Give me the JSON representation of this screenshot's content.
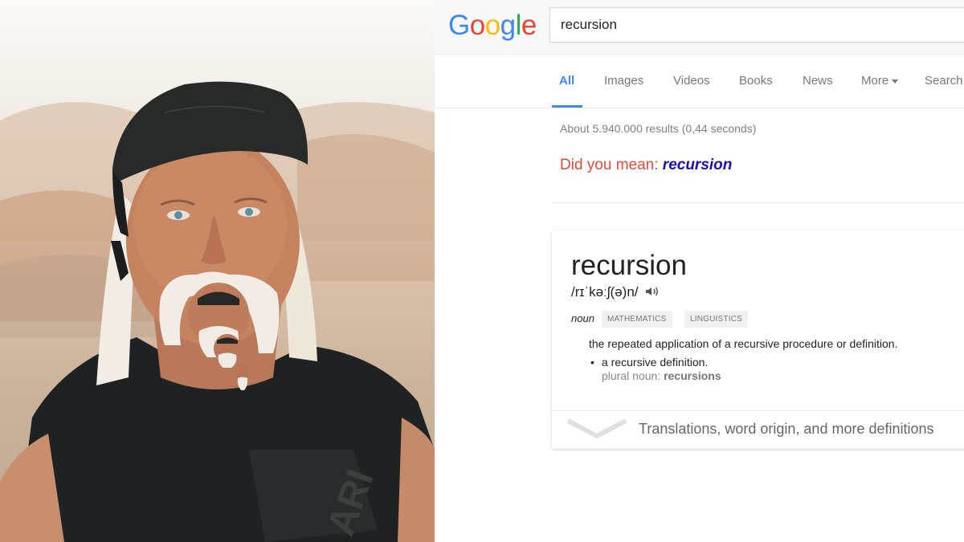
{
  "google": {
    "logo_letters": [
      {
        "char": "G",
        "color": "#4285f4"
      },
      {
        "char": "o",
        "color": "#ea4335"
      },
      {
        "char": "o",
        "color": "#fbbc05"
      },
      {
        "char": "g",
        "color": "#4285f4"
      },
      {
        "char": "l",
        "color": "#34a853"
      },
      {
        "char": "e",
        "color": "#ea4335"
      }
    ],
    "search_value": "recursion",
    "tabs": [
      {
        "label": "All",
        "active": true
      },
      {
        "label": "Images"
      },
      {
        "label": "Videos"
      },
      {
        "label": "Books"
      },
      {
        "label": "News"
      },
      {
        "label": "More"
      },
      {
        "label": "Search"
      }
    ],
    "stats": "About 5.940.000 results (0,44 seconds)",
    "did_you_mean_prefix": "Did you mean:",
    "did_you_mean_link": "recursion",
    "dictionary": {
      "word": "recursion",
      "phonetic": "/rɪˈkəːʃ(ə)n/",
      "speaker_icon": "speaker-icon",
      "part_of_speech": "noun",
      "labels": [
        "MATHEMATICS",
        "LINGUISTICS"
      ],
      "definition": "the repeated application of a recursive procedure or definition.",
      "sub_definition": "a recursive definition.",
      "plural_prefix": "plural noun:",
      "plural": "recursions",
      "more_link": "Translations, word origin, and more definitions",
      "expand_icon": "chevron-down-icon"
    }
  },
  "colors": {
    "google_blue": "#4285f4",
    "did_you_mean_red": "#dd4b39",
    "link_blue": "#1a0dab"
  }
}
